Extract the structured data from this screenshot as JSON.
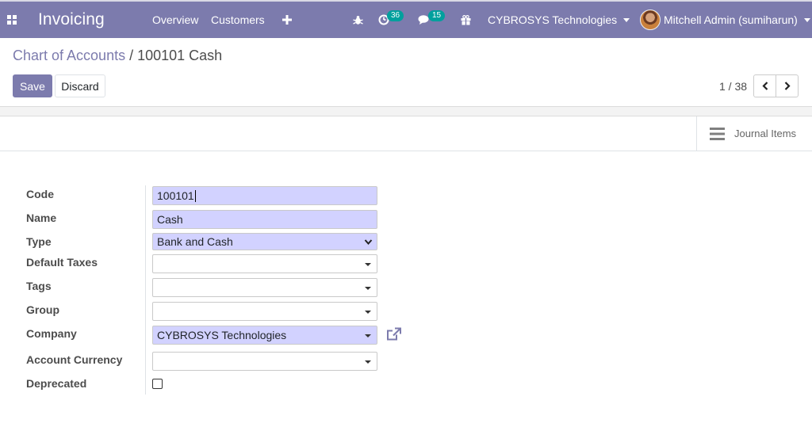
{
  "navbar": {
    "app_title": "Invoicing",
    "menus": [
      "Overview",
      "Customers"
    ],
    "new_icon": "plus-icon",
    "debug_icon": "bug-icon",
    "activity_icon": "clock-icon",
    "activity_count": "36",
    "messages_icon": "chat-icon",
    "messages_count": "15",
    "gift_icon": "gift-icon",
    "company": "CYBROSYS Technologies",
    "user": "Mitchell Admin (sumiharun)"
  },
  "breadcrumb": {
    "parent": "Chart of Accounts",
    "separator": "/",
    "current": "100101 Cash"
  },
  "buttons": {
    "save": "Save",
    "discard": "Discard"
  },
  "pager": {
    "value": "1 / 38"
  },
  "smart_button": {
    "label": "Journal Items",
    "icon": "list-icon"
  },
  "form": {
    "code_label": "Code",
    "code_value": "100101",
    "name_label": "Name",
    "name_value": "Cash",
    "type_label": "Type",
    "type_value": "Bank and Cash",
    "taxes_label": "Default Taxes",
    "taxes_value": "",
    "tags_label": "Tags",
    "tags_value": "",
    "group_label": "Group",
    "group_value": "",
    "company_label": "Company",
    "company_value": "CYBROSYS Technologies",
    "currency_label": "Account Currency",
    "currency_value": "",
    "deprecated_label": "Deprecated",
    "deprecated_checked": false
  },
  "colors": {
    "navbar": "#7c7bad",
    "primary": "#7c7bad",
    "required_field": "#d2d2ff",
    "badge": "#00a09d"
  }
}
